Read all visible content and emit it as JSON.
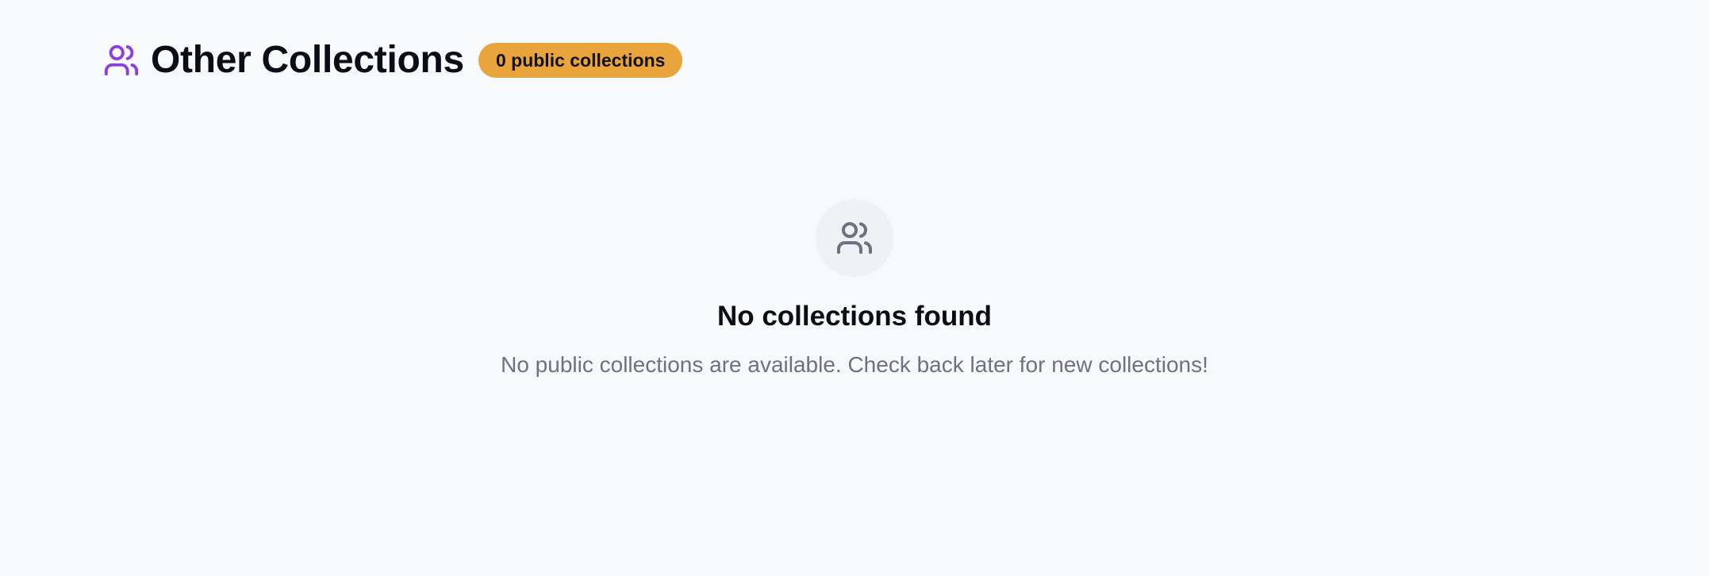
{
  "header": {
    "icon": "users-icon",
    "icon_color": "#8b3fe0",
    "title": "Other Collections",
    "badge": "0 public collections",
    "badge_color": "#eaa43c"
  },
  "empty_state": {
    "icon": "users-icon",
    "title": "No collections found",
    "message": "No public collections are available. Check back later for new collections!"
  }
}
